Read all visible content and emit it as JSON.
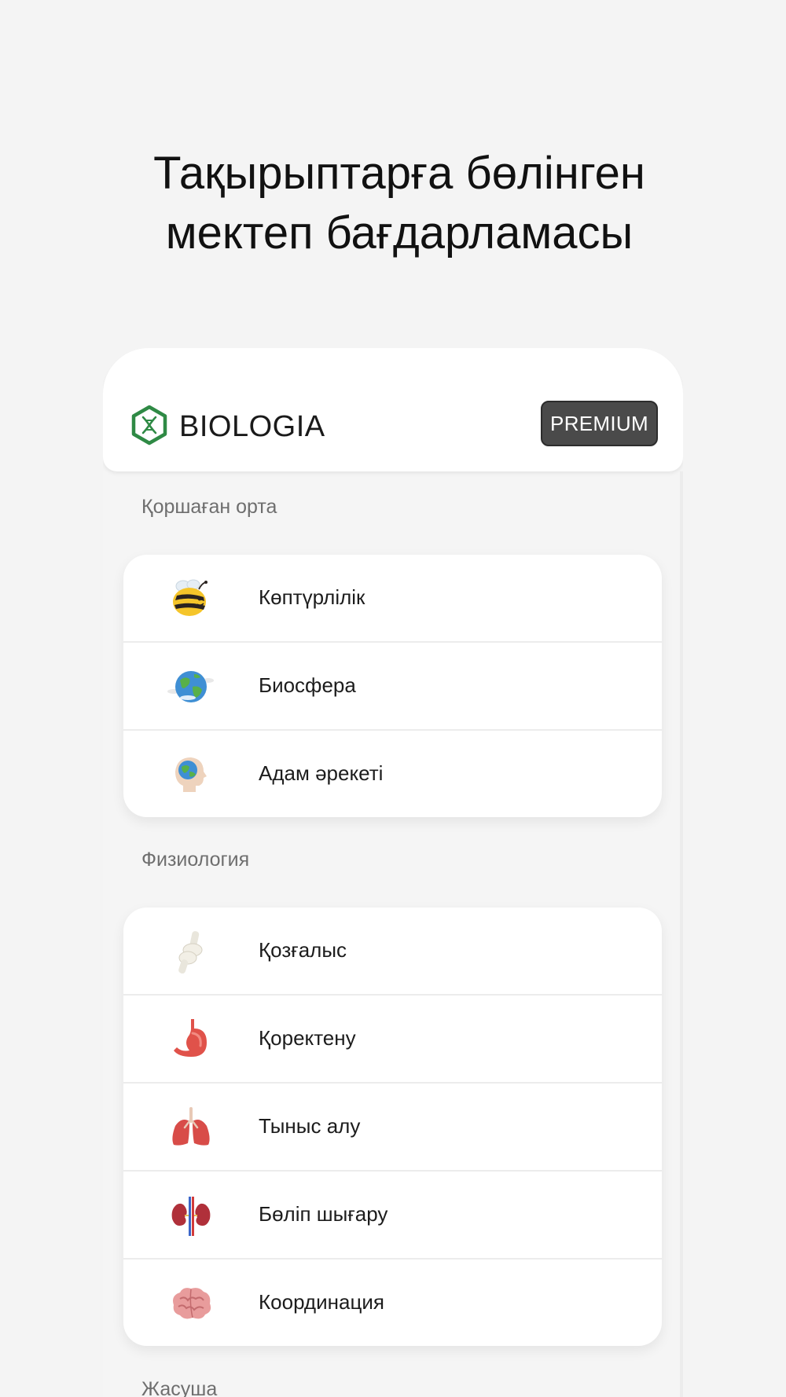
{
  "promo": {
    "line1": "Тақырыптарға бөлінген",
    "line2": "мектеп бағдарламасы"
  },
  "header": {
    "logo_icon": "dna-hexagon-icon",
    "app_name": "BIOLOGIA",
    "premium_label": "PREMIUM"
  },
  "sections": [
    {
      "title": "Қоршаған орта",
      "items": [
        {
          "label": "Көптүрлілік",
          "icon": "bee-icon"
        },
        {
          "label": "Биосфера",
          "icon": "earth-globe-icon"
        },
        {
          "label": "Адам әрекеті",
          "icon": "head-globe-icon"
        }
      ]
    },
    {
      "title": "Физиология",
      "items": [
        {
          "label": "Қозғалыс",
          "icon": "bone-joint-icon"
        },
        {
          "label": "Қоректену",
          "icon": "stomach-icon"
        },
        {
          "label": "Тыныс алу",
          "icon": "lungs-icon"
        },
        {
          "label": "Бөліп шығару",
          "icon": "kidneys-icon"
        },
        {
          "label": "Координация",
          "icon": "brain-icon"
        }
      ]
    },
    {
      "title": "Жасуша"
    }
  ],
  "colors": {
    "background": "#f4f4f4",
    "logo_green": "#2f8a45",
    "premium_bg": "#4a4a4a"
  }
}
